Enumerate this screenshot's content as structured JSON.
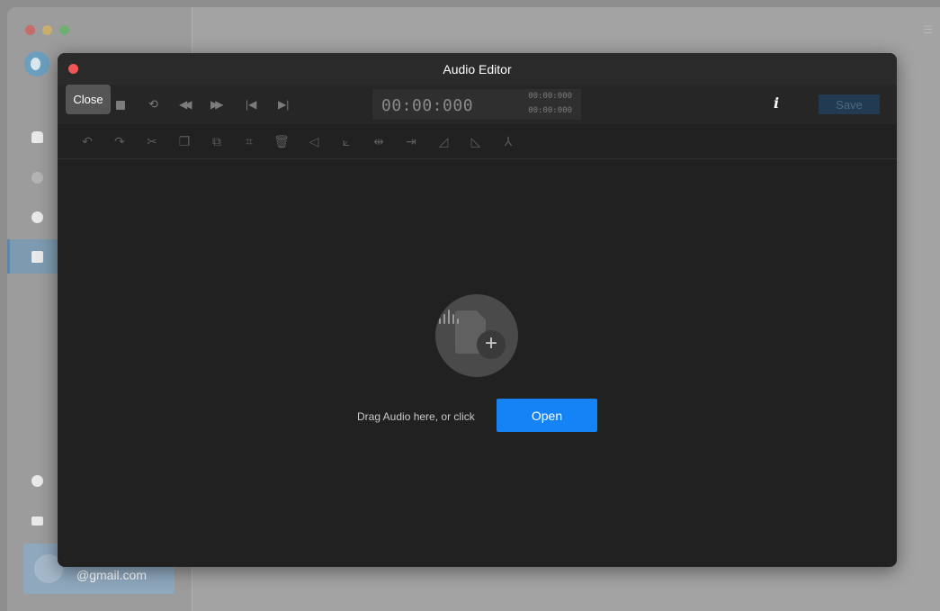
{
  "background_app": {
    "user_email": "@gmail.com",
    "menu_icon": "hamburger-icon"
  },
  "dialog": {
    "title": "Audio Editor",
    "close_tooltip": "Close",
    "transport": {
      "timecode": "00:00:000",
      "selection_start": "00:00:000",
      "selection_end": "00:00:000",
      "info_label": "i",
      "save_label": "Save"
    },
    "edit_toolbar_icons": [
      "undo-icon",
      "redo-icon",
      "cut-icon",
      "copy-icon",
      "paste-icon",
      "crop-icon",
      "delete-icon",
      "volume-icon",
      "fade-icon",
      "speed-icon",
      "silence-icon",
      "fade-in-icon",
      "fade-out-icon",
      "split-icon"
    ],
    "drop_zone": {
      "prompt": "Drag Audio here, or click",
      "open_label": "Open"
    }
  },
  "colors": {
    "accent": "#1583f5",
    "close_dot": "#ef5757",
    "dialog_bg": "#212121"
  }
}
